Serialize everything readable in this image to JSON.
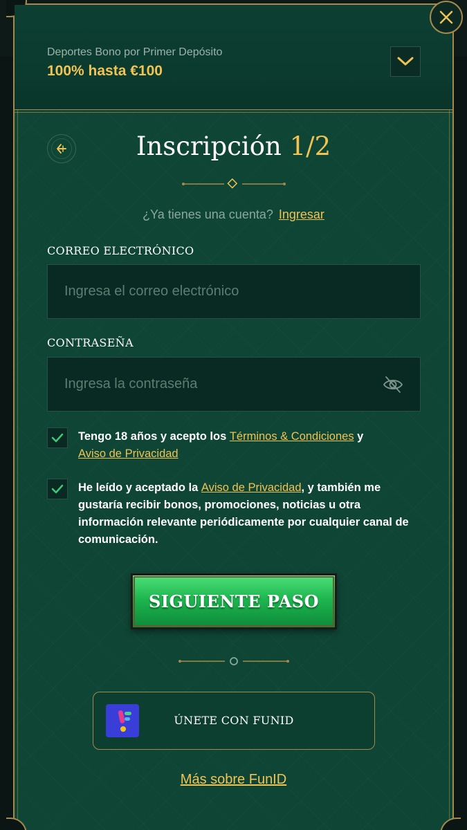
{
  "bonus": {
    "label": "Deportes Bono por Primer Depósito",
    "value": "100% hasta €100"
  },
  "form": {
    "title": "Inscripción",
    "step": "1/2",
    "login_question": "¿Ya tienes una cuenta?",
    "login_link": "Ingresar",
    "email_label": "CORREO ELECTRÓNICO",
    "email_placeholder": "Ingresa el correo electrónico",
    "password_label": "CONTRASEÑA",
    "password_placeholder": "Ingresa la contraseña",
    "consent1": {
      "checked": true,
      "text_before": "Tengo 18 años y acepto los ",
      "terms_link": "Términos & Condiciones",
      "text_mid": " y",
      "privacy_link": "Aviso de Privacidad"
    },
    "consent2": {
      "checked": true,
      "text_before": "He leído y aceptado la ",
      "privacy_link": "Aviso de Privacidad",
      "text_after": ", y también me gustaría recibir bonos, promociones, noticias u otra información relevante periódicamente por cualquier canal de comunicación."
    },
    "next_button": "SIGUIENTE PASO",
    "funid_button": "ÚNETE CON FUNID",
    "funid_more_link": "Más sobre FunID"
  },
  "icons": {
    "close": "close-icon",
    "chevron": "chevron-down-icon",
    "back": "back-arrow-icon",
    "eye": "eye-off-icon",
    "check": "checkmark-icon",
    "funid": "funid-logo-icon"
  },
  "colors": {
    "accent_gold": "#f0c354",
    "panel_green": "#0f4535",
    "button_green": "#1eb64f",
    "border_gold": "#a68a4c"
  }
}
